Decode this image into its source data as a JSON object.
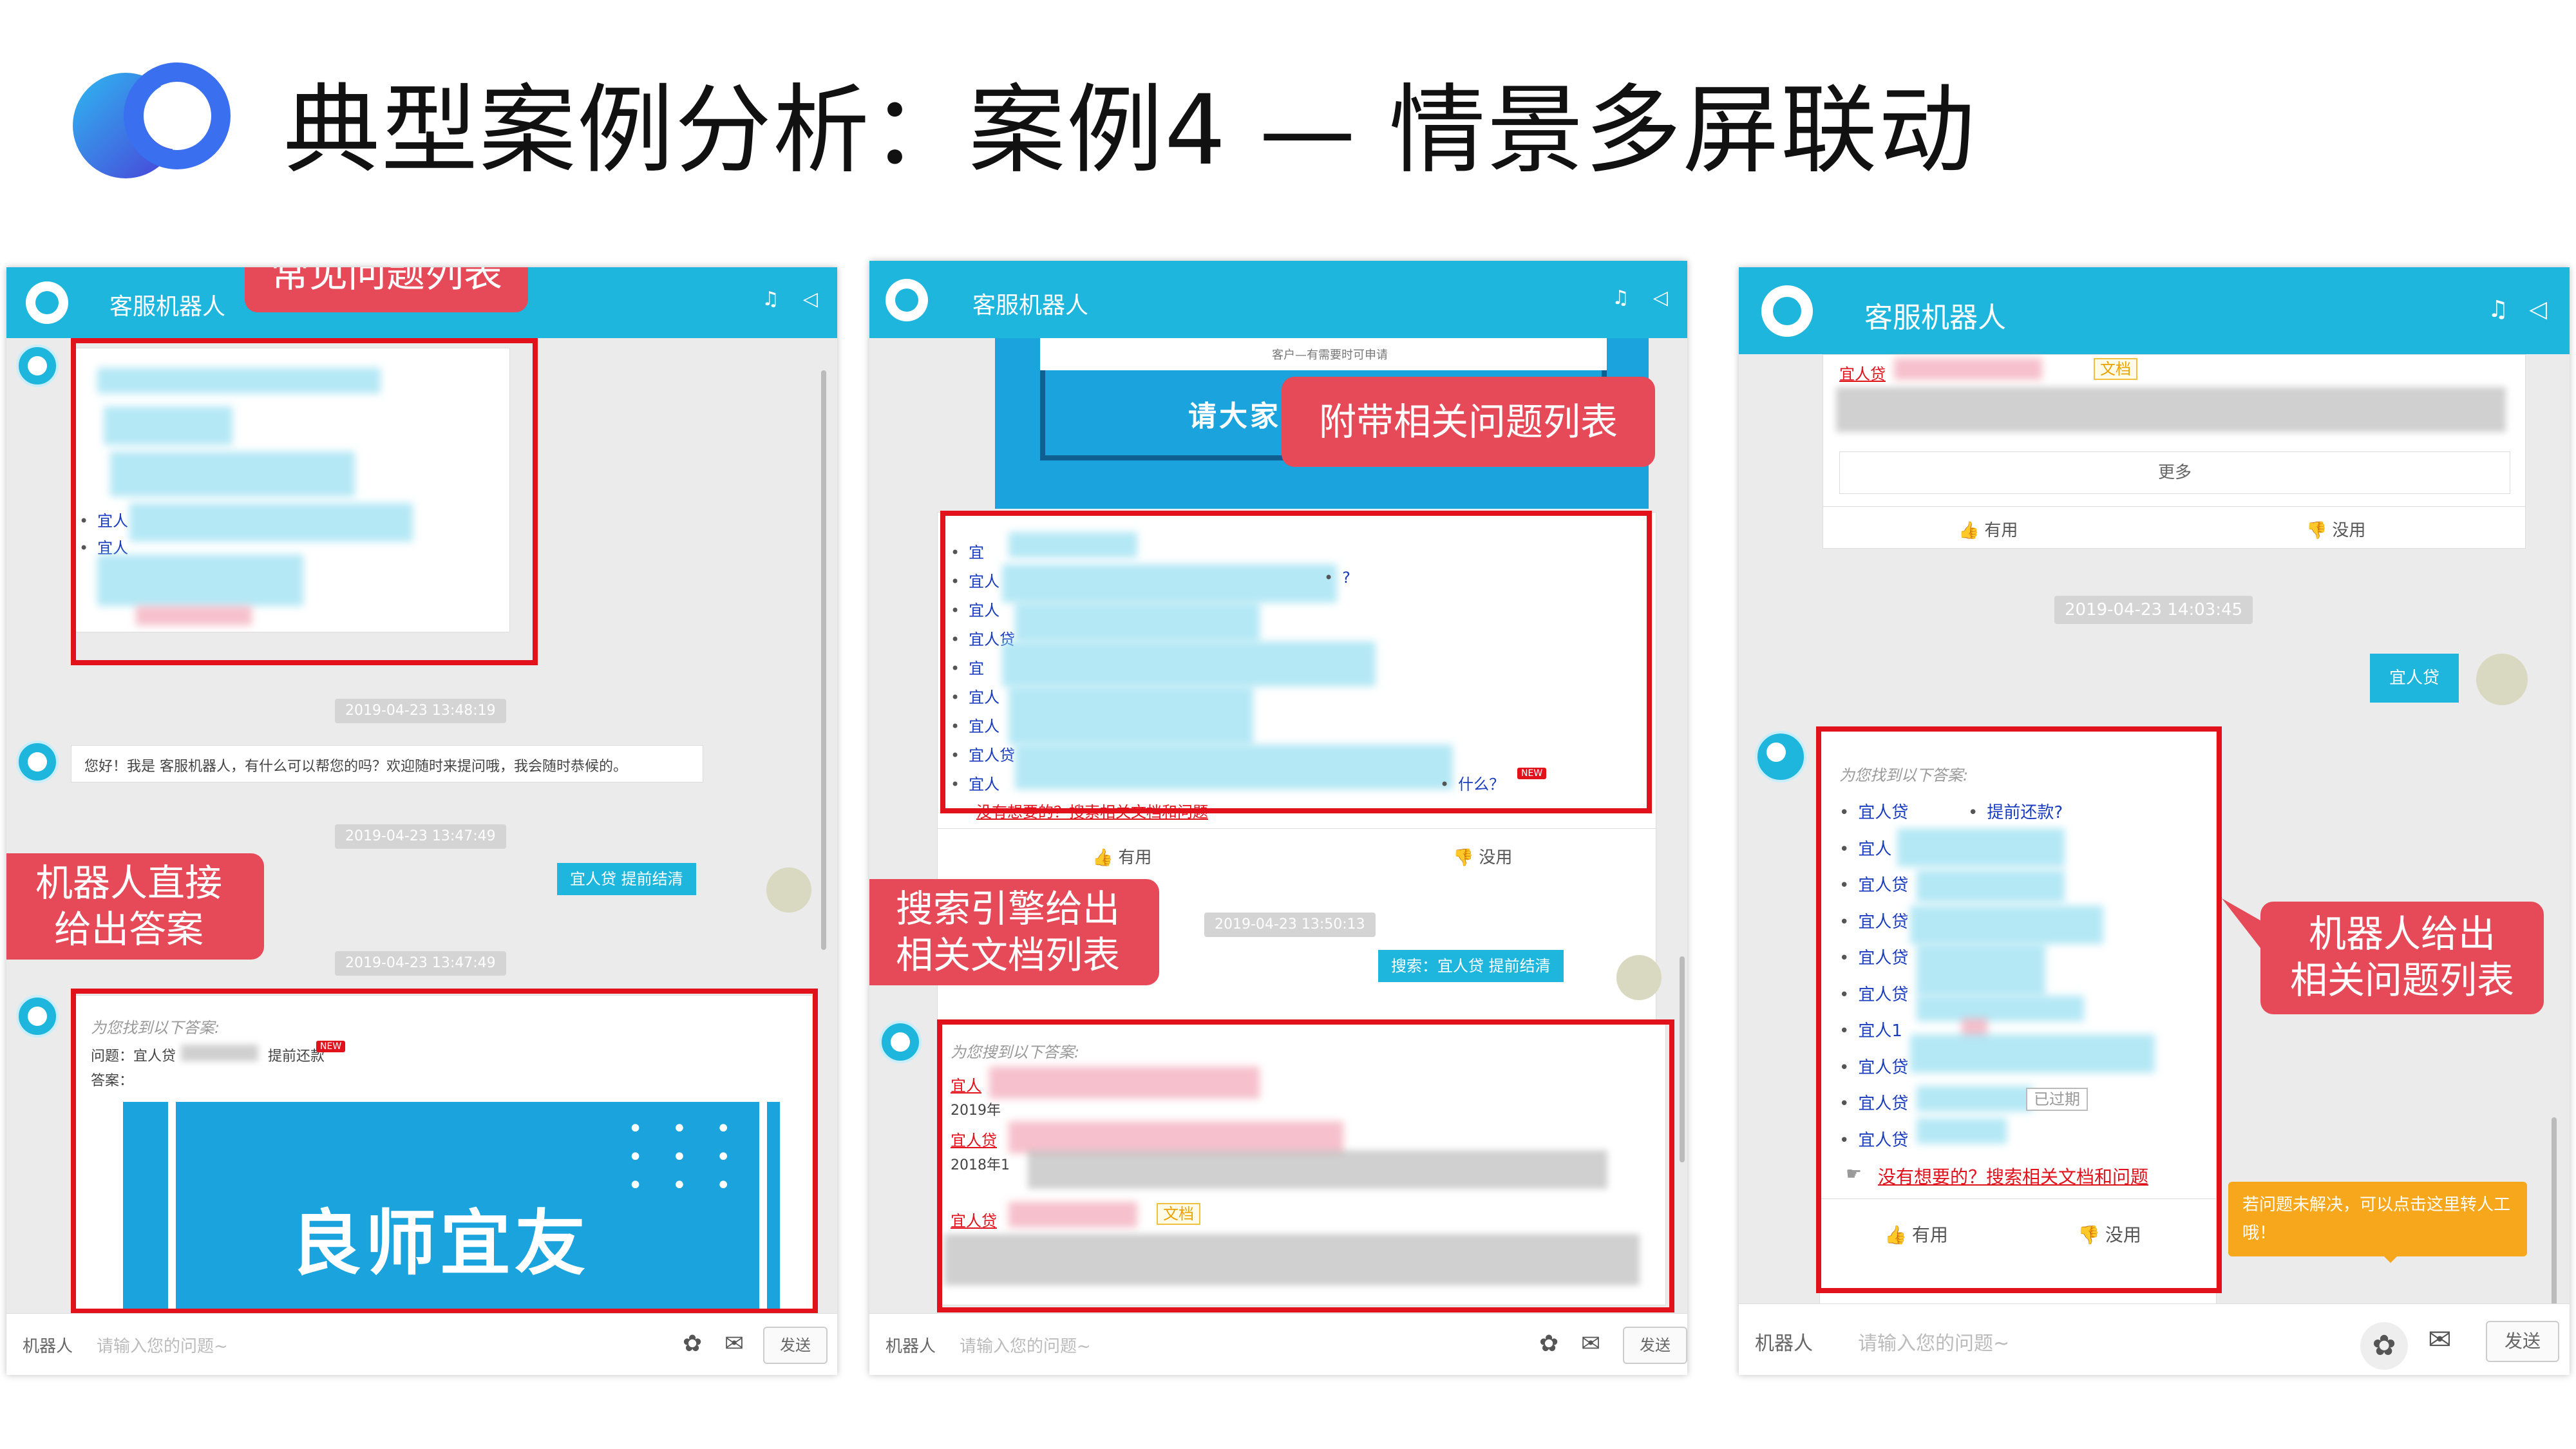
{
  "slide": {
    "title": "典型案例分析：案例4 — 情景多屏联动"
  },
  "colors": {
    "header": "#1eb6dc",
    "highlight": "#e1121c",
    "callout": "#e64a58",
    "transfer": "#f7a71b"
  },
  "panel1": {
    "header_title": "客服机器人",
    "callout_top": "常见问题列表",
    "faq_items": [
      "宜人",
      "宜人"
    ],
    "ts1": "2019-04-23 13:48:19",
    "greeting": "您好！我是    客服机器人，有什么可以帮您的吗？欢迎随时来提问哦，我会随时恭候的。",
    "ts2": "2019-04-23 13:47:49",
    "user_msg": "宜人贷           提前结清",
    "callout_mid": "机器人直接\n给出答案",
    "ts3": "2019-04-23 13:47:49",
    "answer_intro": "为您找到以下答案:",
    "question_label": "问题：宜人贷",
    "question_tail": "提前还款",
    "new_badge": "NEW",
    "answer_label": "答案：",
    "banner_text": "良师宜友",
    "input_robot": "机器人",
    "input_placeholder": "请输入您的问题~",
    "send": "发送"
  },
  "panel2": {
    "header_title": "客服机器人",
    "top_notice": "客户—有需要时可申请",
    "banner_text": "请大家",
    "callout_top": "附带相关问题列表",
    "related": [
      "宜",
      "宜人",
      "宜人",
      "宜人贷",
      "宜",
      "宜人",
      "宜人",
      "宜人贷",
      "宜人"
    ],
    "related_tail_q": "?",
    "related_tail_last": "什么？",
    "new_badge": "NEW",
    "search_link": "没有想要的？搜索相关文档和问题",
    "useful": "有用",
    "useless": "没用",
    "ts": "2019-04-23 13:50:13",
    "callout_mid": "搜索引擎给出\n相关文档列表",
    "user_msg": "搜索：宜人贷           提前结清",
    "search_intro": "为您搜到以下答案:",
    "docs": [
      "宜人",
      "宜人贷",
      "宜人贷"
    ],
    "doc_dates": [
      "2019年",
      "2018年1"
    ],
    "doc_tag": "文档",
    "input_robot": "机器人",
    "input_placeholder": "请输入您的问题~",
    "send": "发送"
  },
  "panel3": {
    "header_title": "客服机器人",
    "top_item": "宜人贷",
    "top_tag": "文档",
    "more": "更多",
    "useful": "有用",
    "useless": "没用",
    "ts": "2019-04-23 14:03:45",
    "user_msg": "宜人贷",
    "answer_intro": "为您找到以下答案:",
    "items": [
      "宜人贷",
      "宜人",
      "宜人贷",
      "宜人贷",
      "宜人贷",
      "宜人贷",
      "宜人1",
      "宜人贷",
      "宜人贷",
      "宜人贷"
    ],
    "first_tail": "提前还款?",
    "expired_tag": "已过期",
    "search_link": "没有想要的？搜索相关文档和问题",
    "useful2": "有用",
    "useless2": "没用",
    "callout_right": "机器人给出\n相关问题列表",
    "transfer_tip": "若问题未解决，可以点击这里转人工哦！",
    "input_robot": "机器人",
    "input_placeholder": "请输入您的问题~",
    "send": "发送"
  }
}
